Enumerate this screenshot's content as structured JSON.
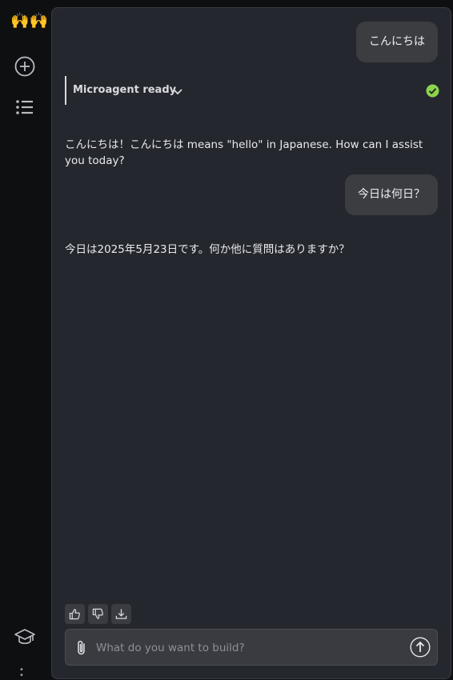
{
  "sidebar": {
    "logo_emoji": "🙌🙌",
    "icons": [
      "new-chat-icon",
      "list-icon",
      "graduation-cap-icon"
    ]
  },
  "chat": {
    "messages": [
      {
        "role": "user",
        "text": "こんにちは"
      },
      {
        "role": "assistant",
        "text": "こんにちは！こんにちは means \"hello\" in Japanese. How can I assist you today?"
      },
      {
        "role": "user",
        "text": "今日は何日？"
      },
      {
        "role": "assistant",
        "text": "今日は2025年5月23日です。何か他に質問はありますか？"
      }
    ],
    "status": {
      "label": "Microagent ready",
      "state_color": "#8bd450"
    }
  },
  "composer": {
    "placeholder": "What do you want to build?"
  },
  "colors": {
    "background": "#0e0f11",
    "panel": "#25272e",
    "bubble": "#3c3d41",
    "accent_green": "#8bd450"
  }
}
